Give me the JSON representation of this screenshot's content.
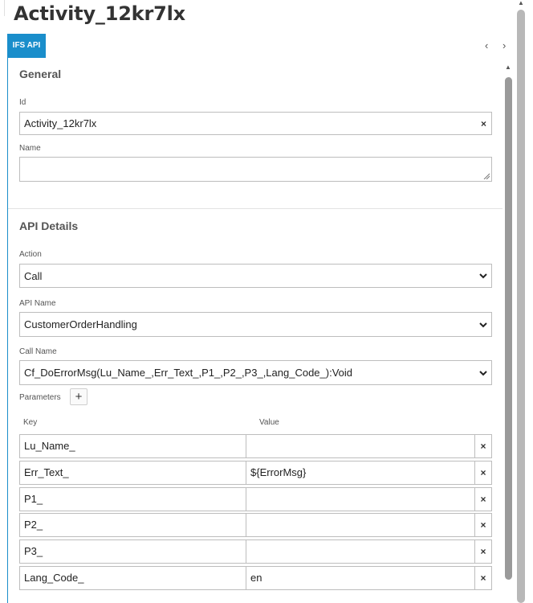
{
  "window": {
    "title": "Activity_12kr7lx"
  },
  "tabs": {
    "active_label": "IFS API",
    "prev_icon": "‹",
    "next_icon": "›"
  },
  "general": {
    "heading": "General",
    "id_label": "Id",
    "id_value": "Activity_12kr7lx",
    "name_label": "Name",
    "name_value": ""
  },
  "api_details": {
    "heading": "API Details",
    "action_label": "Action",
    "action_value": "Call",
    "api_name_label": "API Name",
    "api_name_value": "CustomerOrderHandling",
    "call_name_label": "Call Name",
    "call_name_value": "Cf_DoErrorMsg(Lu_Name_,Err_Text_,P1_,P2_,P3_,Lang_Code_):Void",
    "parameters_label": "Parameters",
    "add_icon": "+",
    "key_header": "Key",
    "value_header": "Value",
    "parameters": [
      {
        "key": "Lu_Name_",
        "value": ""
      },
      {
        "key": "Err_Text_",
        "value": "${ErrorMsg}"
      },
      {
        "key": "P1_",
        "value": ""
      },
      {
        "key": "P2_",
        "value": ""
      },
      {
        "key": "P3_",
        "value": ""
      },
      {
        "key": "Lang_Code_",
        "value": "en"
      }
    ]
  },
  "icons": {
    "clear": "×",
    "delete": "×",
    "chevron": "chevron-down-icon",
    "scroll_up": "▲"
  },
  "colors": {
    "accent": "#1a8ecb",
    "text": "#333333",
    "label": "#555555",
    "border": "#bdbdbd"
  }
}
